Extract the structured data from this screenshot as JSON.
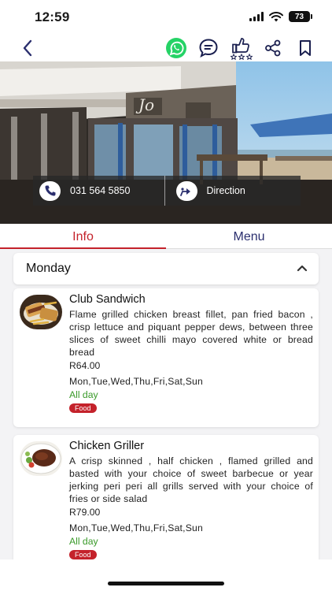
{
  "status": {
    "time": "12:59",
    "battery": "73"
  },
  "toolbar": {
    "back": "chevron-left-icon",
    "actions": [
      "whatsapp-icon",
      "chat-icon",
      "rating-thumb-icon",
      "share-icon",
      "bookmark-icon"
    ],
    "accent": "#2b2f6e",
    "whatsapp_color": "#25d366"
  },
  "hero": {
    "phone_label": "031 564 5850",
    "direction_label": "Direction",
    "sign_text": "Jo"
  },
  "tabs": {
    "info": "Info",
    "menu": "Menu",
    "active": "info",
    "active_color": "#c4222b"
  },
  "menu": {
    "day": "Monday",
    "items": [
      {
        "name": "Club Sandwich",
        "description": "Flame grilled chicken breast fillet, pan fried bacon , crisp lettuce and piquant pepper dews, between three slices of sweet chilli mayo covered white or bread bread",
        "price": "R64.00",
        "days": "Mon,Tue,Wed,Thu,Fri,Sat,Sun",
        "availability": "All day",
        "tag": "Food"
      },
      {
        "name": "Chicken Griller",
        "description": "A crisp skinned , half chicken , flamed grilled and basted with your choice of sweet barbecue or year jerking peri peri all grills served with your choice of fries or side salad",
        "price": "R79.00",
        "days": "Mon,Tue,Wed,Thu,Fri,Sat,Sun",
        "availability": "All day",
        "tag": "Food"
      }
    ]
  }
}
